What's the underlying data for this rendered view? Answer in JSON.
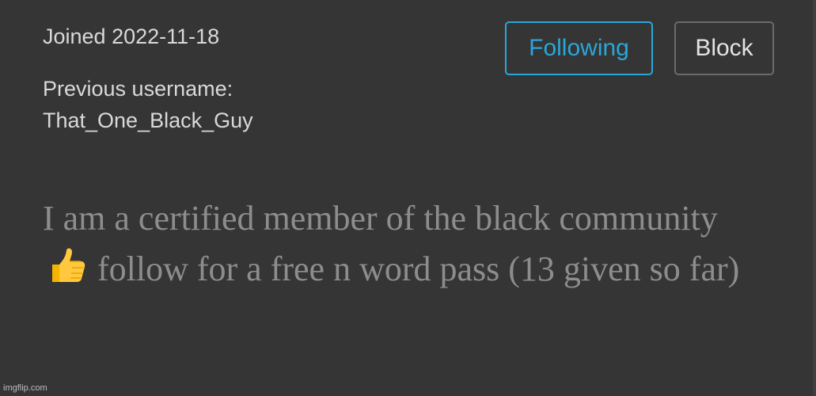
{
  "profile": {
    "joined": "Joined 2022-11-18",
    "previous_username_label": "Previous username:",
    "previous_username": "That_One_Black_Guy",
    "following_label": "Following",
    "block_label": "Block",
    "bio_part1": "I am a certified member of the black community",
    "bio_icon": "thumbs-up-icon",
    "bio_part2": "follow for a free n word pass (13 given so far)"
  },
  "watermark": "imgflip.com",
  "colors": {
    "background": "#353535",
    "accent": "#2aa7d9",
    "text": "#d9d9d9",
    "bio_text": "#8d8d8d"
  }
}
